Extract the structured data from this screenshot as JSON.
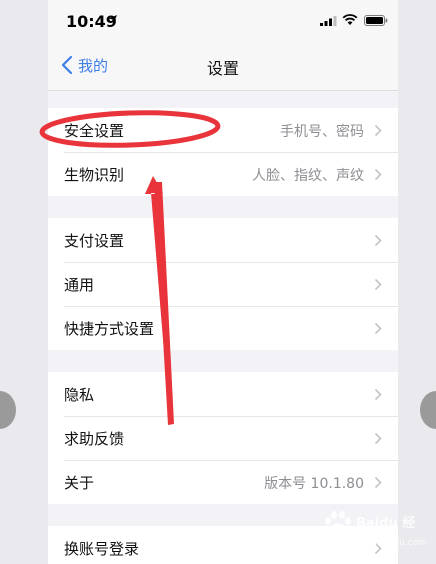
{
  "status_bar": {
    "time": "10:49"
  },
  "nav": {
    "back_label": "我的",
    "title": "设置"
  },
  "groups": [
    {
      "rows": [
        {
          "label": "安全设置",
          "value": "手机号、密码"
        },
        {
          "label": "生物识别",
          "value": "人脸、指纹、声纹"
        }
      ]
    },
    {
      "rows": [
        {
          "label": "支付设置",
          "value": ""
        },
        {
          "label": "通用",
          "value": ""
        },
        {
          "label": "快捷方式设置",
          "value": ""
        }
      ]
    },
    {
      "rows": [
        {
          "label": "隐私",
          "value": ""
        },
        {
          "label": "求助反馈",
          "value": ""
        },
        {
          "label": "关于",
          "value": "版本号 10.1.80"
        }
      ]
    },
    {
      "rows": [
        {
          "label": "换账号登录",
          "value": ""
        }
      ]
    }
  ],
  "annotation": {
    "color": "#e8343a"
  },
  "watermark": {
    "text": "Baidu 经验",
    "sub": "jingyan.baidu.com"
  },
  "colors": {
    "accent": "#3f7ee8",
    "background": "#f2f2f7"
  },
  "icons": [
    "location-arrow-icon",
    "cellular-signal-icon",
    "wifi-icon",
    "battery-icon",
    "chevron-left-icon",
    "chevron-right-icon"
  ]
}
